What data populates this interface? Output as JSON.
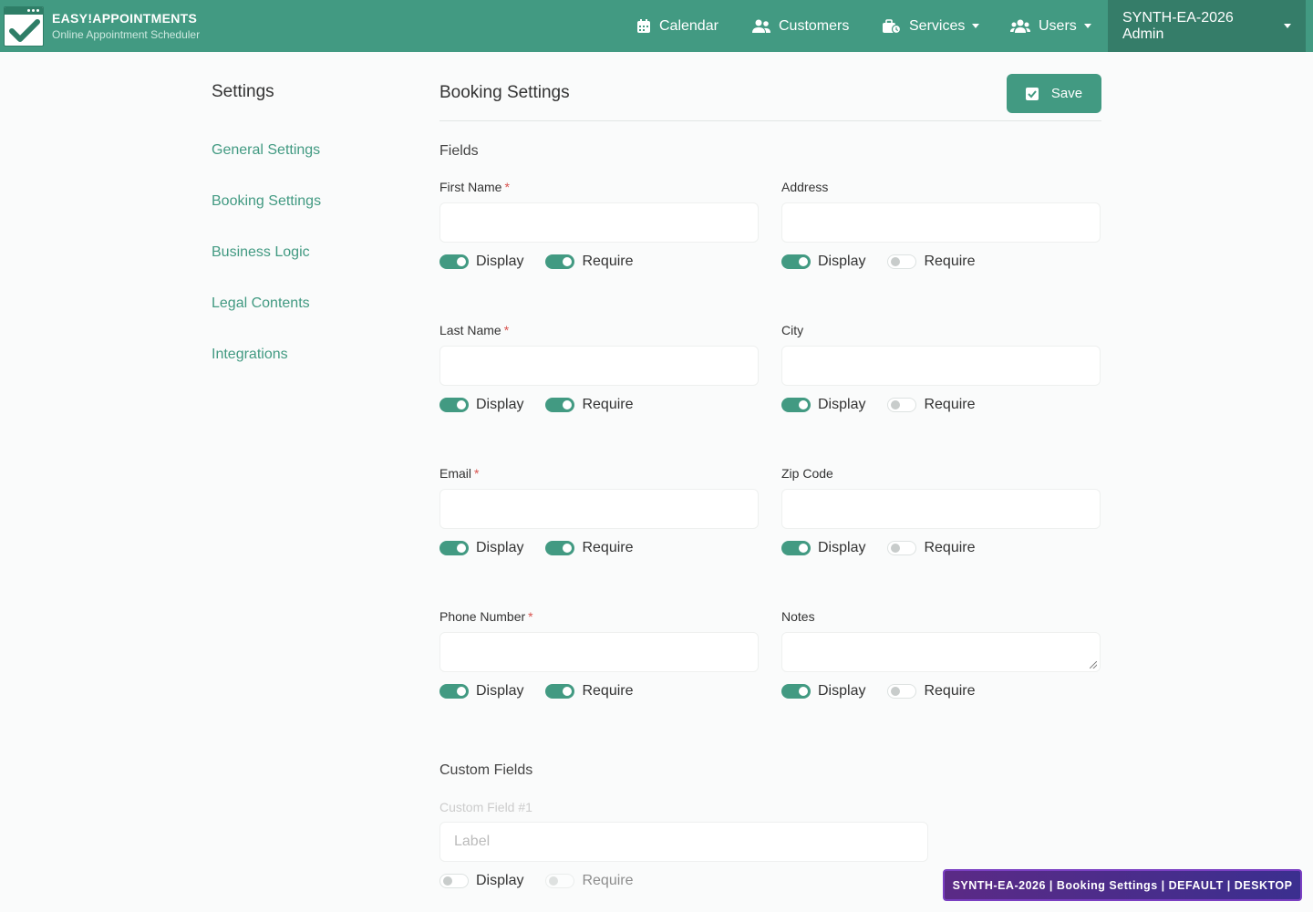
{
  "brand": {
    "title": "EASY!APPOINTMENTS",
    "subtitle": "Online Appointment Scheduler"
  },
  "nav": {
    "calendar": "Calendar",
    "customers": "Customers",
    "services": "Services",
    "users": "Users",
    "admin": "SYNTH-EA-2026 Admin"
  },
  "sidebar": {
    "title": "Settings",
    "items": [
      "General Settings",
      "Booking Settings",
      "Business Logic",
      "Legal Contents",
      "Integrations"
    ]
  },
  "main": {
    "title": "Booking Settings",
    "save_label": "Save",
    "fields_title": "Fields",
    "custom_title": "Custom Fields"
  },
  "fields": [
    {
      "label": "First Name",
      "required_mark": "*",
      "display": true,
      "require": true
    },
    {
      "label": "Address",
      "required_mark": "",
      "display": true,
      "require": false
    },
    {
      "label": "Last Name",
      "required_mark": "*",
      "display": true,
      "require": true
    },
    {
      "label": "City",
      "required_mark": "",
      "display": true,
      "require": false
    },
    {
      "label": "Email",
      "required_mark": "*",
      "display": true,
      "require": true
    },
    {
      "label": "Zip Code",
      "required_mark": "",
      "display": true,
      "require": false
    },
    {
      "label": "Phone Number",
      "required_mark": "*",
      "display": true,
      "require": true
    },
    {
      "label": "Notes",
      "required_mark": "",
      "display": true,
      "require": false
    }
  ],
  "toggles": {
    "display": "Display",
    "require": "Require"
  },
  "custom_fields": [
    {
      "title": "Custom Field #1",
      "placeholder": "Label",
      "display": false,
      "require": false
    }
  ],
  "env_badge": "SYNTH-EA-2026 | Booking Settings | DEFAULT | DESKTOP",
  "colors": {
    "primary": "#429a82",
    "navbar": "#429a82",
    "admin_bg": "#357d69",
    "required": "#d9534f"
  }
}
